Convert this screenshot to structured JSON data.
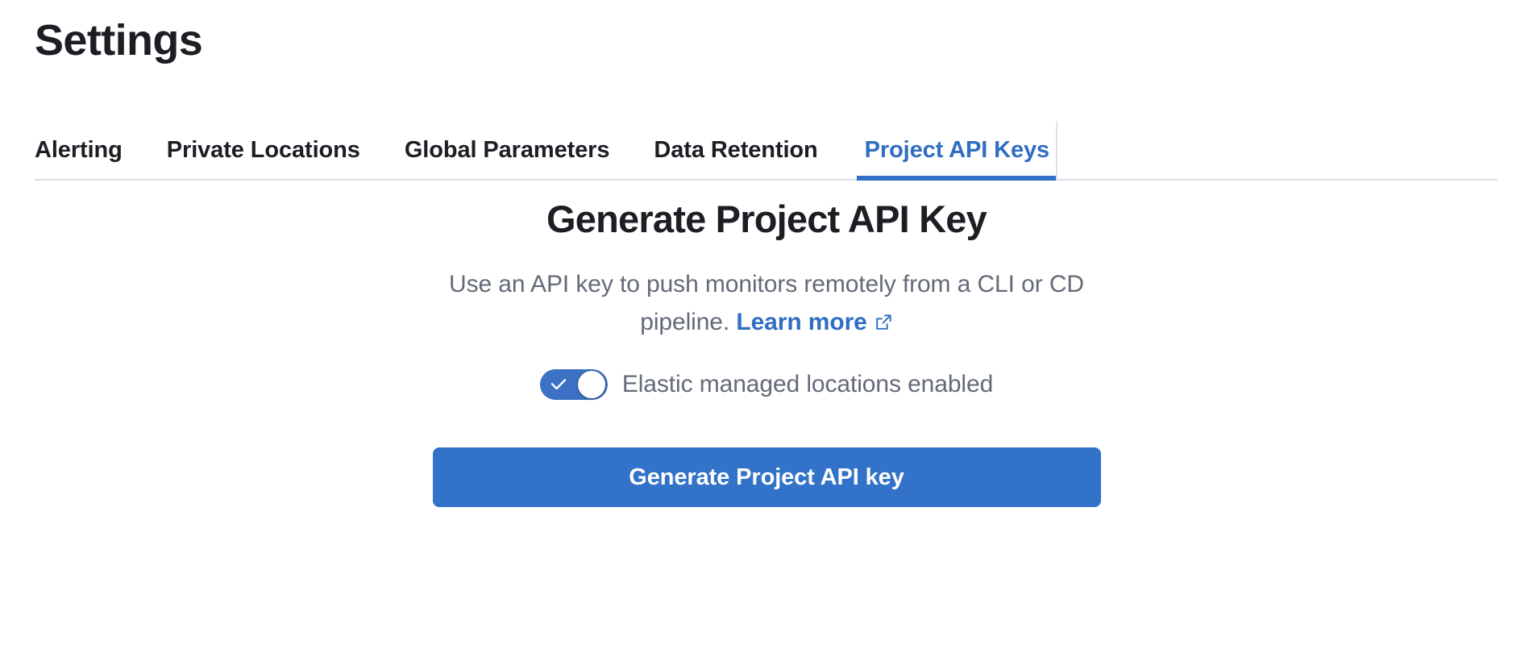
{
  "page": {
    "title": "Settings"
  },
  "tabs": [
    {
      "label": "Alerting",
      "active": false
    },
    {
      "label": "Private Locations",
      "active": false
    },
    {
      "label": "Global Parameters",
      "active": false
    },
    {
      "label": "Data Retention",
      "active": false
    },
    {
      "label": "Project API Keys",
      "active": true
    }
  ],
  "main": {
    "heading": "Generate Project API Key",
    "description_line1": "Use an API key to push monitors remotely from a CLI or",
    "description_line2": "CD pipeline.",
    "learn_more_label": "Learn more",
    "external_link_icon": "external-link-icon",
    "toggle": {
      "label": "Elastic managed locations enabled",
      "state": "on",
      "icon": "check-icon"
    },
    "generate_button_label": "Generate Project API key"
  },
  "colors": {
    "accent_blue": "#3272c8",
    "link_blue": "#2f6ec0",
    "toggle_on": "#3b72c4",
    "text_dark": "#1d1e24",
    "text_muted": "#646a77",
    "border": "#d9dfe8"
  }
}
